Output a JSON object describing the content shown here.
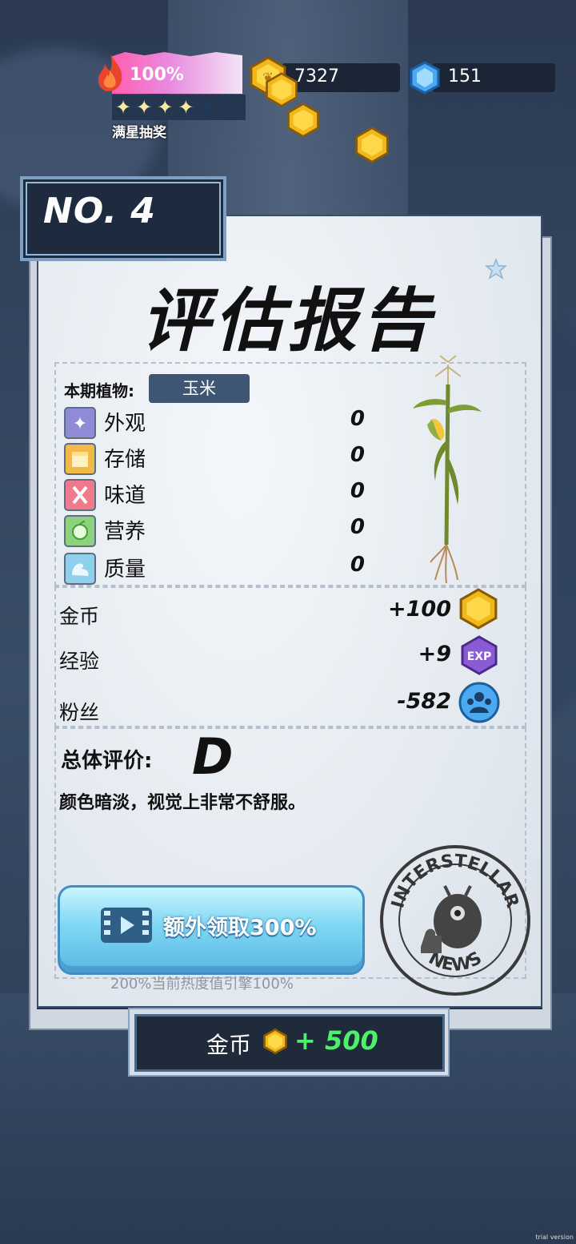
{
  "hud": {
    "heat_percent": "100%",
    "heat_level": 1.0,
    "stars_filled": 4,
    "stars_total": 5,
    "full_star_label": "满星抽奖",
    "coins": "7327",
    "gems": "151"
  },
  "report": {
    "number": "NO. 4",
    "title": "评估报告",
    "plant_label": "本期植物:",
    "plant_name": "玉米",
    "attributes": [
      {
        "label": "外观",
        "value": "0",
        "icon": "sparkle-icon",
        "color": "#8f8bd6"
      },
      {
        "label": "存储",
        "value": "0",
        "icon": "storage-box-icon",
        "color": "#f2b948"
      },
      {
        "label": "味道",
        "value": "0",
        "icon": "fork-knife-icon",
        "color": "#f07a8c"
      },
      {
        "label": "营养",
        "value": "0",
        "icon": "nutrition-icon",
        "color": "#8ed17e"
      },
      {
        "label": "质量",
        "value": "0",
        "icon": "muscle-icon",
        "color": "#8fd0ec"
      }
    ],
    "rewards": [
      {
        "label": "金币",
        "value": "+100",
        "icon": "coin-icon"
      },
      {
        "label": "经验",
        "value": "+9",
        "icon": "exp-icon",
        "icon_text": "EXP"
      },
      {
        "label": "粉丝",
        "value": "-582",
        "icon": "fans-icon"
      }
    ],
    "grade_label": "总体评价:",
    "grade": "D",
    "comment": "颜色暗淡，视觉上非常不舒服。",
    "video_button": "额外领取300%",
    "hint": "200%当前热度值引擎100%",
    "stamp_top": "INTERSTELLAR",
    "stamp_bottom": "NEWS"
  },
  "claim": {
    "label": "金币",
    "value": "+ 500"
  },
  "watermark": "trial version"
}
